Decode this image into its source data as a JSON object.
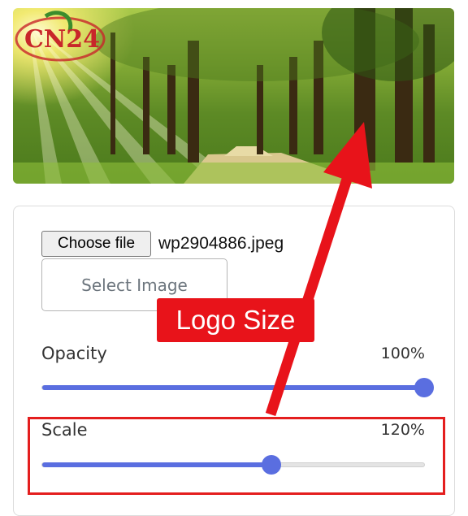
{
  "preview": {
    "logo_text": "CN24"
  },
  "file_input": {
    "button_label": "Choose file",
    "file_name": "wp2904886.jpeg"
  },
  "select_image": {
    "label": "Select Image"
  },
  "opacity": {
    "label": "Opacity",
    "value_text": "100%",
    "fraction": 1.0
  },
  "scale": {
    "label": "Scale",
    "value_text": "120%",
    "fraction": 0.6
  },
  "annotation": {
    "callout_text": "Logo Size",
    "color": "#e8131a"
  },
  "colors": {
    "slider_accent": "#5a6ee0"
  }
}
